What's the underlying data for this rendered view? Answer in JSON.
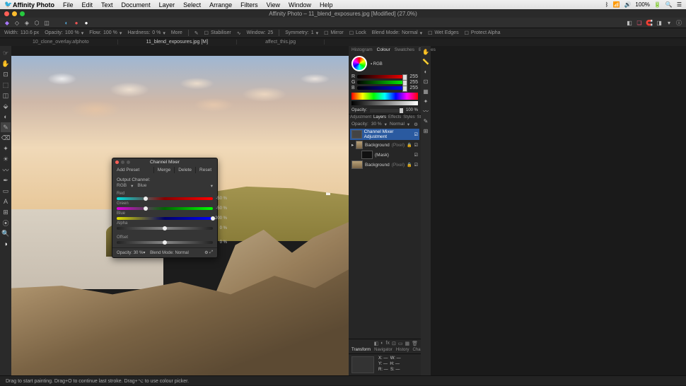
{
  "menubar": {
    "app": "Affinity Photo",
    "items": [
      "File",
      "Edit",
      "Text",
      "Document",
      "Layer",
      "Select",
      "Arrange",
      "Filters",
      "View",
      "Window",
      "Help"
    ],
    "right": {
      "zoom": "100%",
      "time": "",
      "icons": [
        "bt",
        "wifi",
        "vol",
        "batt",
        "search",
        "menu"
      ]
    }
  },
  "titlebar": {
    "title": "Affinity Photo – 11_blend_exposures.jpg [Modified] (27.0%)"
  },
  "contextbar": {
    "width_label": "Width:",
    "width": "110.6 px",
    "opacity_label": "Opacity:",
    "opacity": "100 %",
    "flow_label": "Flow:",
    "flow": "100 %",
    "hardness_label": "Hardness:",
    "hardness": "0 %",
    "more": "More",
    "stabiliser": "Stabiliser",
    "window_label": "Window:",
    "window": "25",
    "symmetry_label": "Symmetry:",
    "symmetry": "1",
    "mirror": "Mirror",
    "lock": "Lock",
    "blendmode_label": "Blend Mode:",
    "blendmode": "Normal",
    "wetedges": "Wet Edges",
    "protect": "Protect Alpha"
  },
  "tabs": {
    "t1": "10_clone_overlay.afphoto",
    "t2": "11_blend_exposures.jpg [M]",
    "t3": "affect_this.jpg"
  },
  "tools": [
    "☞",
    "⬚",
    "⊕",
    "∷",
    "⌖",
    "⬉",
    "◧",
    "▦",
    "✎",
    "✏",
    "✐",
    "★",
    "▭",
    "⬤",
    "△",
    "⦿",
    "∅",
    "⌀",
    "A",
    "◐",
    "●"
  ],
  "channel_mixer": {
    "title": "Channel Mixer",
    "add_preset": "Add Preset",
    "merge": "Merge",
    "delete": "Delete",
    "reset": "Reset",
    "output_channel": "Output Channel:",
    "mode": "RGB",
    "channel": "Blue",
    "sliders": {
      "Red": {
        "value": "-50 %",
        "pos": 30,
        "bg": "linear-gradient(to right,#0ff,#000,#f00)"
      },
      "Green": {
        "value": "-50 %",
        "pos": 30,
        "bg": "linear-gradient(to right,#f0f,#000,#0f0)"
      },
      "Blue": {
        "value": "200 %",
        "pos": 100,
        "bg": "linear-gradient(to right,#ff0,#000,#00f)"
      },
      "Alpha": {
        "value": "0 %",
        "pos": 50,
        "bg": "linear-gradient(to right,#000,#666,#000)"
      }
    },
    "offset_label": "Offset",
    "offset": {
      "value": "0 %",
      "pos": 50,
      "bg": "linear-gradient(to right,#000,#666,#000)"
    },
    "opacity_label": "Opacity:",
    "opacity_val": "30 %",
    "blend_label": "Blend Mode:",
    "blend_val": "Normal"
  },
  "right_panel": {
    "tabs1": [
      "Histogram",
      "Colour",
      "Swatches",
      "Brushes"
    ],
    "tabs1_active": "Colour",
    "mode": "RGB",
    "rgb": {
      "R": "255",
      "G": "255",
      "B": "255"
    },
    "opacity_label": "Opacity:",
    "opacity_val": "100 %",
    "tabs2": [
      "Adjustment",
      "Layers",
      "Effects",
      "Styles",
      "Stock"
    ],
    "tabs2_active": "Layers",
    "layer_opacity_label": "Opacity:",
    "layer_opacity": "30 %",
    "layer_blend": "Normal",
    "layers": [
      {
        "name": "Channel Mixer Adjustment",
        "type": "adj",
        "selected": true,
        "visible": true
      },
      {
        "name": "Background",
        "hint": "(Pixel)",
        "type": "img",
        "visible": true,
        "locked": true
      },
      {
        "name": "(Mask)",
        "type": "mask",
        "visible": true
      },
      {
        "name": "Background",
        "hint": "(Pixel)",
        "type": "img",
        "visible": true,
        "locked": true
      }
    ],
    "tabs3": [
      "Transform",
      "Navigator",
      "History",
      "Channels"
    ],
    "tabs3_active": "Transform",
    "transform": {
      "X": "X:",
      "Y": "Y:",
      "W": "W:",
      "H": "H:",
      "R": "R:",
      "S": "S:"
    }
  },
  "status": {
    "text": "Drag to start painting. Drag+O to continue last stroke. Drag+⌥ to use colour picker."
  }
}
